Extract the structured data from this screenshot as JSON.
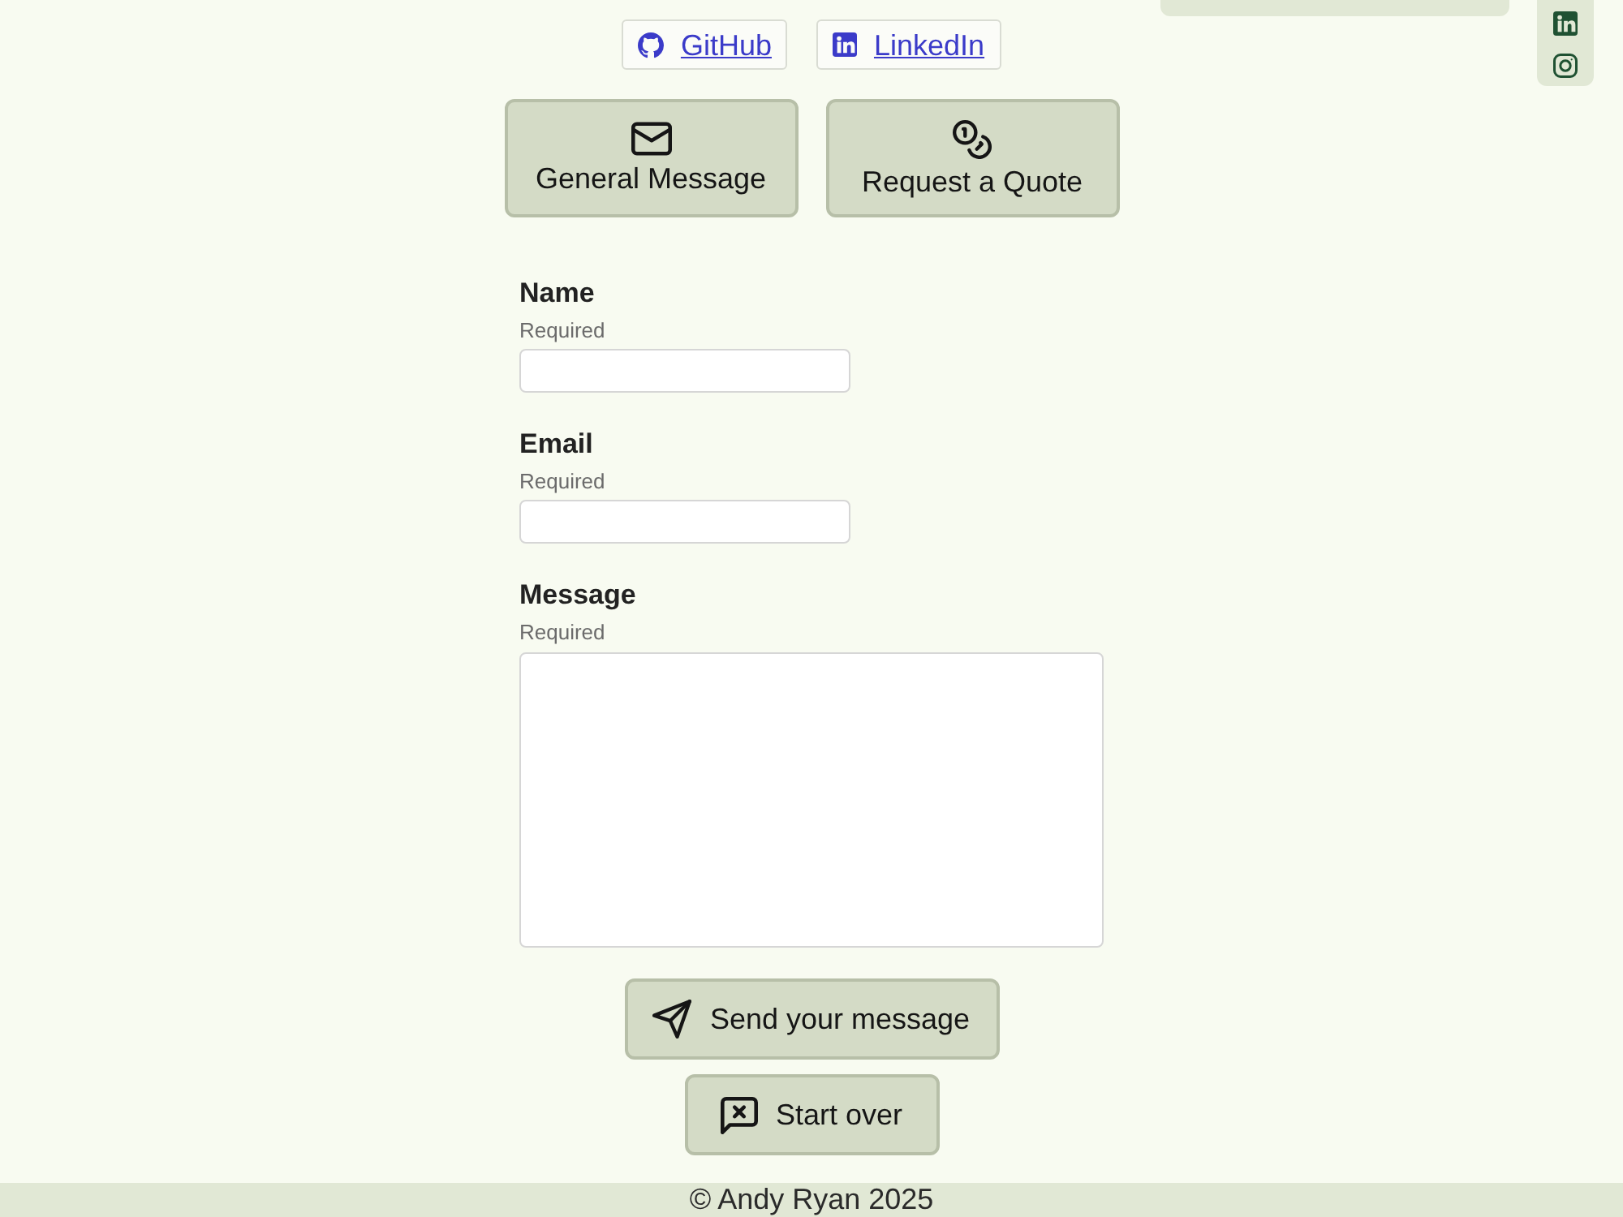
{
  "social_links": [
    {
      "kind": "github",
      "label": "GitHub"
    },
    {
      "kind": "linkedin",
      "label": "LinkedIn"
    }
  ],
  "message_types": [
    {
      "kind": "mail",
      "label": "General Message"
    },
    {
      "kind": "coins",
      "label": "Request a Quote"
    }
  ],
  "fields": [
    {
      "kind": "input",
      "label": "Name",
      "hint": "Required"
    },
    {
      "kind": "input",
      "label": "Email",
      "hint": "Required"
    },
    {
      "kind": "textarea",
      "label": "Message",
      "hint": "Required"
    }
  ],
  "actions": [
    {
      "kind": "send",
      "label": "Send your message"
    },
    {
      "kind": "reset",
      "label": "Start over"
    }
  ],
  "footer": {
    "copyright": "© Andy Ryan 2025"
  }
}
